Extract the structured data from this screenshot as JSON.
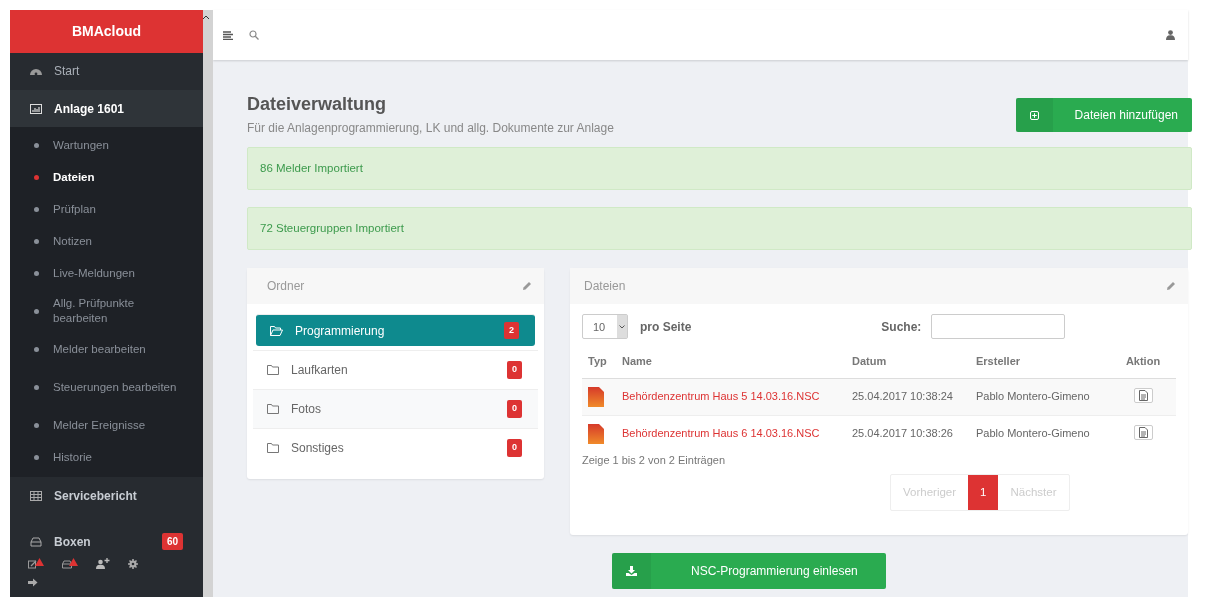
{
  "brand": "BMAcloud",
  "sidebar": {
    "items": [
      {
        "kind": "section",
        "label": "Start",
        "expanded": false
      },
      {
        "kind": "section",
        "label": "Anlage 1601",
        "expanded": true,
        "children": [
          {
            "label": "Wartungen",
            "selected": false
          },
          {
            "label": "Dateien",
            "selected": true
          },
          {
            "label": "Prüfplan",
            "selected": false
          },
          {
            "label": "Notizen",
            "selected": false
          },
          {
            "label": "Live-Meldungen",
            "selected": false
          },
          {
            "label": "Allg. Prüfpunkte bearbeiten",
            "selected": false
          },
          {
            "label": "Melder bearbeiten",
            "selected": false
          },
          {
            "label": "Steuerungen bearbeiten",
            "selected": false
          },
          {
            "label": "Melder Ereignisse",
            "selected": false
          },
          {
            "label": "Historie",
            "selected": false
          }
        ]
      },
      {
        "kind": "section",
        "label": "Servicebericht",
        "expanded": false
      },
      {
        "kind": "section",
        "label": "Boxen",
        "expanded": false,
        "badge": "60"
      }
    ]
  },
  "page": {
    "title": "Dateiverwaltung",
    "subtitle": "Für die Anlagenprogrammierung, LK und allg. Dokumente zur Anlage",
    "add_button": "Dateien hinzufügen"
  },
  "alerts": [
    "86 Melder Importiert",
    "72 Steuergruppen Importiert"
  ],
  "folders": {
    "title": "Ordner",
    "items": [
      {
        "label": "Programmierung",
        "count": "2",
        "selected": true
      },
      {
        "label": "Laufkarten",
        "count": "0",
        "selected": false
      },
      {
        "label": "Fotos",
        "count": "0",
        "selected": false
      },
      {
        "label": "Sonstiges",
        "count": "0",
        "selected": false
      }
    ]
  },
  "files": {
    "title": "Dateien",
    "per_page": "10",
    "per_page_label": "pro Seite",
    "search_label": "Suche:",
    "columns": [
      "Typ",
      "Name",
      "Datum",
      "Ersteller",
      "Aktion"
    ],
    "rows": [
      {
        "name": "Behördenzentrum Haus 5 14.03.16.NSC",
        "date": "25.04.2017 10:38:24",
        "author": "Pablo Montero-Gimeno"
      },
      {
        "name": "Behördenzentrum Haus 6 14.03.16.NSC",
        "date": "25.04.2017 10:38:26",
        "author": "Pablo Montero-Gimeno"
      }
    ],
    "info": "Zeige 1 bis 2 von 2 Einträgen",
    "pagination": [
      {
        "label": "Vorheriger",
        "selected": false,
        "disabled": true
      },
      {
        "label": "1",
        "selected": true,
        "disabled": false
      },
      {
        "label": "Nächster",
        "selected": false,
        "disabled": true
      }
    ]
  },
  "import_button": "NSC-Programmierung einlesen"
}
